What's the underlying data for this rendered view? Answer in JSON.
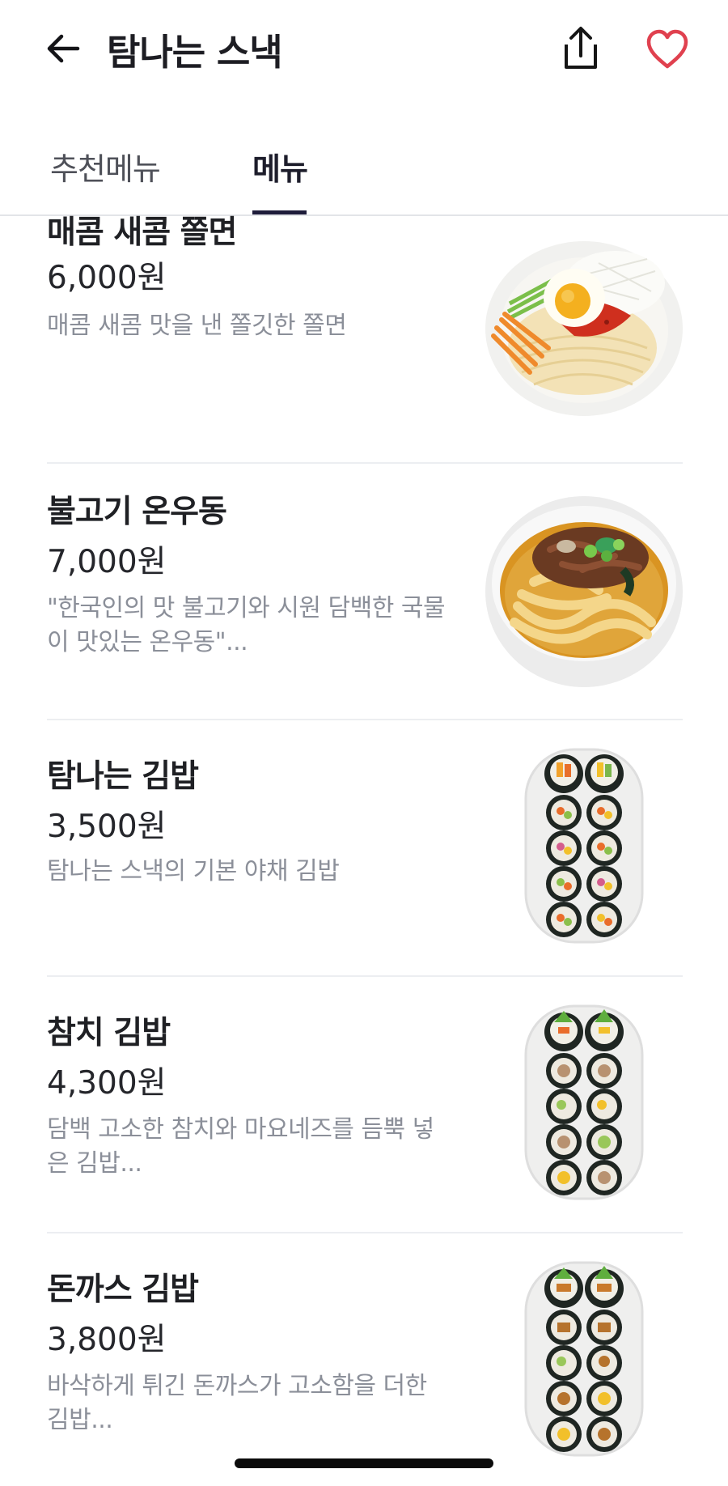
{
  "header": {
    "title": "탐나는 스낵",
    "back_icon": "arrow-left-icon",
    "share_icon": "share-icon",
    "heart_icon": "heart-icon",
    "heart_color": "#e0414f"
  },
  "tabs": [
    {
      "label": "추천메뉴",
      "active": false
    },
    {
      "label": "메뉴",
      "active": true
    }
  ],
  "menu": {
    "items": [
      {
        "name": "매콤 새콤 쫄면",
        "price": "6,000원",
        "description": "매콤 새콤 맛을 낸 쫄깃한 쫄면",
        "image": "jjolmyeon-image"
      },
      {
        "name": "불고기 온우동",
        "price": "7,000원",
        "description": "\"한국인의 맛 불고기와 시원 담백한 국물이 맛있는 온우동\"...",
        "image": "udon-image"
      },
      {
        "name": "탐나는 김밥",
        "price": "3,500원",
        "description": "탐나는 스낵의 기본 야채 김밥",
        "image": "gimbap-image"
      },
      {
        "name": "참치 김밥",
        "price": "4,300원",
        "description": "담백 고소한 참치와 마요네즈를 듬뿍 넣은 김밥...",
        "image": "tuna-gimbap-image"
      },
      {
        "name": "돈까스 김밥",
        "price": "3,800원",
        "description": "바삭하게 튀긴 돈까스가 고소함을 더한 김밥...",
        "image": "donkatsu-gimbap-image"
      }
    ]
  }
}
